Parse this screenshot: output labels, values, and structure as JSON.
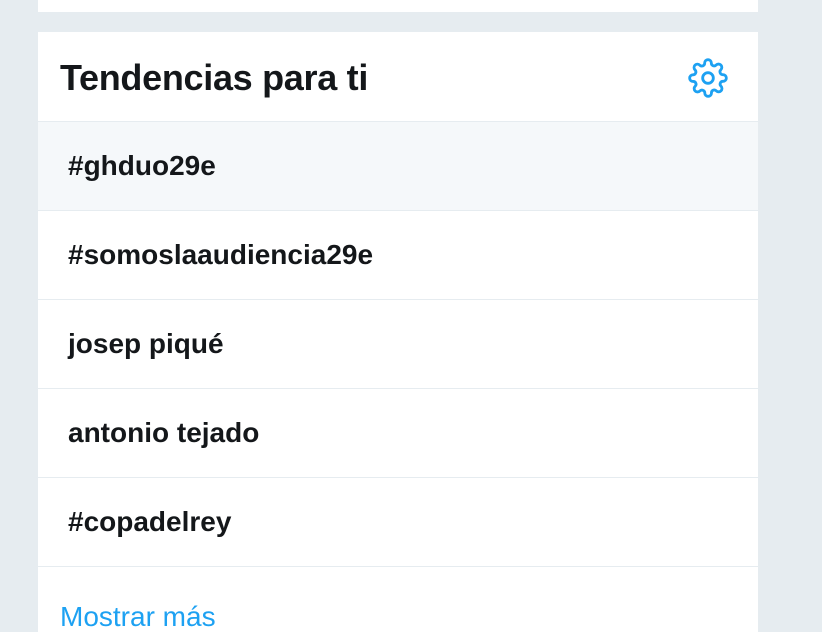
{
  "trends_panel": {
    "title": "Tendencias para ti",
    "settings_icon": "gear-icon",
    "accent_color": "#1da1f2",
    "hover_bg": "#f5f8fa",
    "items": [
      {
        "label": "#ghduo29e"
      },
      {
        "label": "#somoslaaudiencia29e"
      },
      {
        "label": "josep piqué"
      },
      {
        "label": "antonio tejado"
      },
      {
        "label": "#copadelrey"
      }
    ],
    "show_more_label": "Mostrar más"
  }
}
